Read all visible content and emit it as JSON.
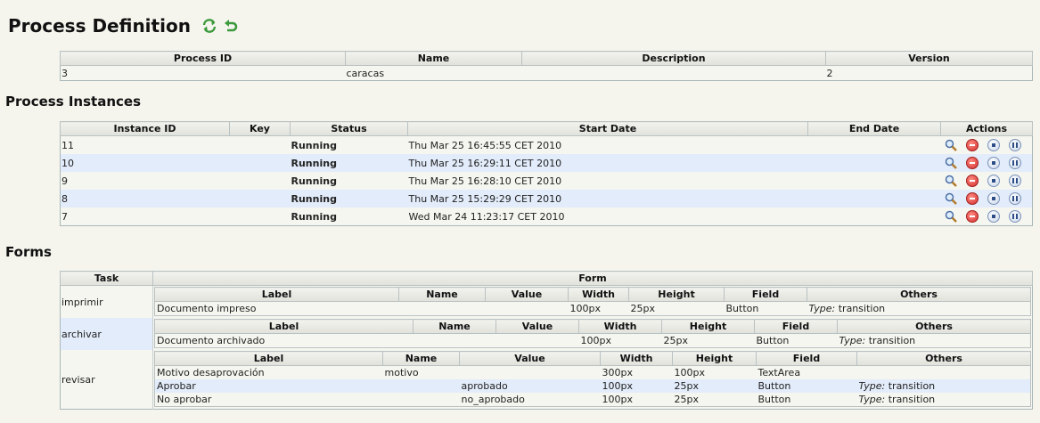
{
  "page_title": "Process Definition",
  "icons": {
    "refresh": "refresh-icon",
    "back": "back-arrow-icon",
    "view": "magnifier-icon",
    "delete": "delete-icon",
    "stop": "stop-icon",
    "pause": "pause-icon"
  },
  "definition": {
    "headers": [
      "Process ID",
      "Name",
      "Description",
      "Version"
    ],
    "row": {
      "id": "3",
      "name": "caracas",
      "description": "",
      "version": "2"
    }
  },
  "instances": {
    "heading": "Process Instances",
    "headers": [
      "Instance ID",
      "Key",
      "Status",
      "Start Date",
      "End Date",
      "Actions"
    ],
    "rows": [
      {
        "id": "11",
        "key": "",
        "status": "Running",
        "start": "Thu Mar 25 16:45:55 CET 2010",
        "end": ""
      },
      {
        "id": "10",
        "key": "",
        "status": "Running",
        "start": "Thu Mar 25 16:29:11 CET 2010",
        "end": ""
      },
      {
        "id": "9",
        "key": "",
        "status": "Running",
        "start": "Thu Mar 25 16:28:10 CET 2010",
        "end": ""
      },
      {
        "id": "8",
        "key": "",
        "status": "Running",
        "start": "Thu Mar 25 15:29:29 CET 2010",
        "end": ""
      },
      {
        "id": "7",
        "key": "",
        "status": "Running",
        "start": "Wed Mar 24 11:23:17 CET 2010",
        "end": ""
      }
    ]
  },
  "forms": {
    "heading": "Forms",
    "headers": [
      "Task",
      "Form"
    ],
    "inner_headers": [
      "Label",
      "Name",
      "Value",
      "Width",
      "Height",
      "Field",
      "Others"
    ],
    "type_label": "Type:",
    "tasks": [
      {
        "task": "imprimir",
        "fields": [
          {
            "label": "Documento impreso",
            "name": "",
            "value": "",
            "width": "100px",
            "height": "25px",
            "field": "Button",
            "others": "transition"
          }
        ]
      },
      {
        "task": "archivar",
        "fields": [
          {
            "label": "Documento archivado",
            "name": "",
            "value": "",
            "width": "100px",
            "height": "25px",
            "field": "Button",
            "others": "transition"
          }
        ]
      },
      {
        "task": "revisar",
        "fields": [
          {
            "label": "Motivo desaprovación",
            "name": "motivo",
            "value": "",
            "width": "300px",
            "height": "100px",
            "field": "TextArea",
            "others": ""
          },
          {
            "label": "Aprobar",
            "name": "",
            "value": "aprobado",
            "width": "100px",
            "height": "25px",
            "field": "Button",
            "others": "transition"
          },
          {
            "label": "No aprobar",
            "name": "",
            "value": "no_aprobado",
            "width": "100px",
            "height": "25px",
            "field": "Button",
            "others": "transition"
          }
        ]
      }
    ]
  }
}
